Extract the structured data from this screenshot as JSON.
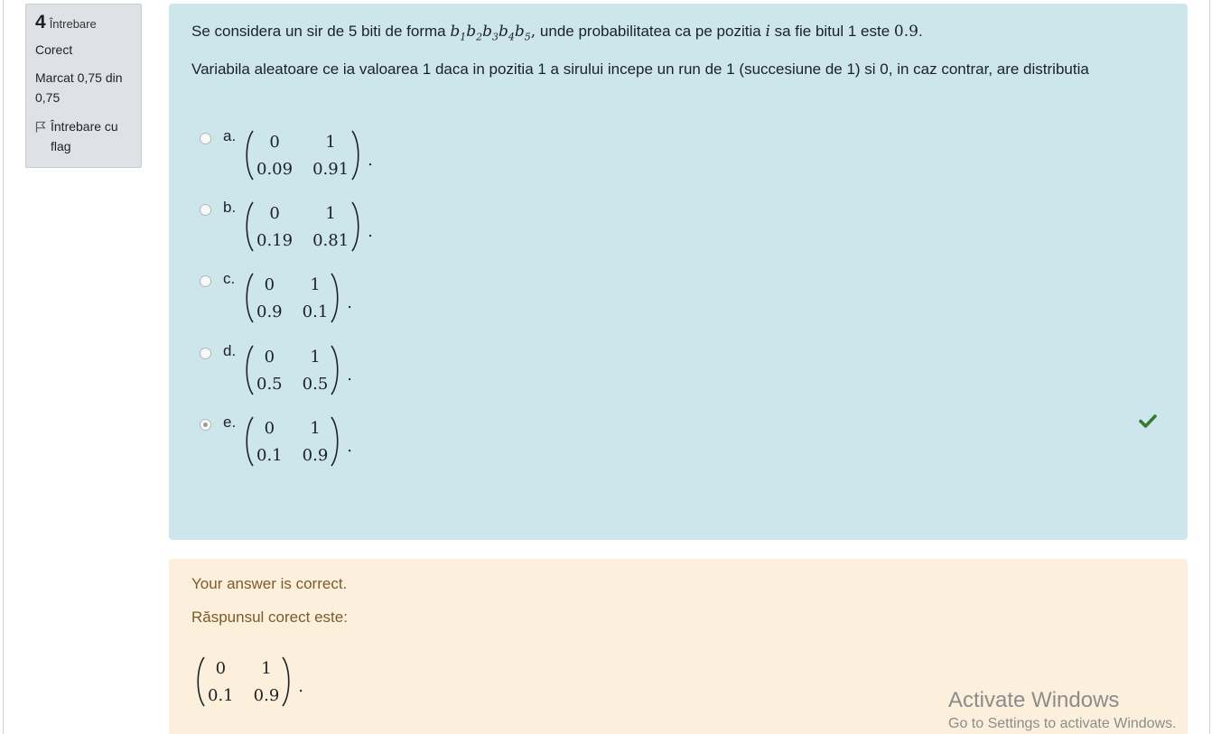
{
  "info": {
    "number": "4",
    "number_label": "Întrebare",
    "state": "Corect",
    "grade": "Marcat 0,75 din 0,75",
    "flag_label": "Întrebare cu flag"
  },
  "question": {
    "intro_before": "Se considera un sir de 5 biti de forma ",
    "b": "b",
    "subs": [
      "1",
      "2",
      "3",
      "4",
      "5"
    ],
    "comma": ",",
    "intro_middle": " unde probabilitatea ca pe pozitia ",
    "i_var": "i",
    "intro_after": " sa fie bitul 1 este ",
    "p_value": "0.9",
    "period": ".",
    "line2": "Variabila aleatoare ce ia valoarea 1 daca in pozitia 1 a sirului incepe un run de 1 (succesiune de 1) si 0, in caz contrar, are distributia"
  },
  "options": [
    {
      "letter": "a.",
      "top": [
        "0",
        "1"
      ],
      "bottom": [
        "0.09",
        "0.91"
      ],
      "selected": false
    },
    {
      "letter": "b.",
      "top": [
        "0",
        "1"
      ],
      "bottom": [
        "0.19",
        "0.81"
      ],
      "selected": false
    },
    {
      "letter": "c.",
      "top": [
        "0",
        "1"
      ],
      "bottom": [
        "0.9",
        "0.1"
      ],
      "selected": false
    },
    {
      "letter": "d.",
      "top": [
        "0",
        "1"
      ],
      "bottom": [
        "0.5",
        "0.5"
      ],
      "selected": false
    },
    {
      "letter": "e.",
      "top": [
        "0",
        "1"
      ],
      "bottom": [
        "0.1",
        "0.9"
      ],
      "selected": true
    }
  ],
  "matrix_suffix": ".",
  "correct_icon": "check-icon",
  "feedback": {
    "result": "Your answer is correct.",
    "right_answer_label": "Răspunsul corect este:",
    "matrix": {
      "top": [
        "0",
        "1"
      ],
      "bottom": [
        "0.1",
        "0.9"
      ]
    }
  },
  "watermark": {
    "title": "Activate Windows",
    "subtitle": "Go to Settings to activate Windows."
  },
  "colors": {
    "formulation_bg": "#cde6eb",
    "feedback_bg": "#fcefdc",
    "feedback_text": "#7d5a29",
    "info_bg": "#dee2e6",
    "correct_green": "#357a32"
  }
}
